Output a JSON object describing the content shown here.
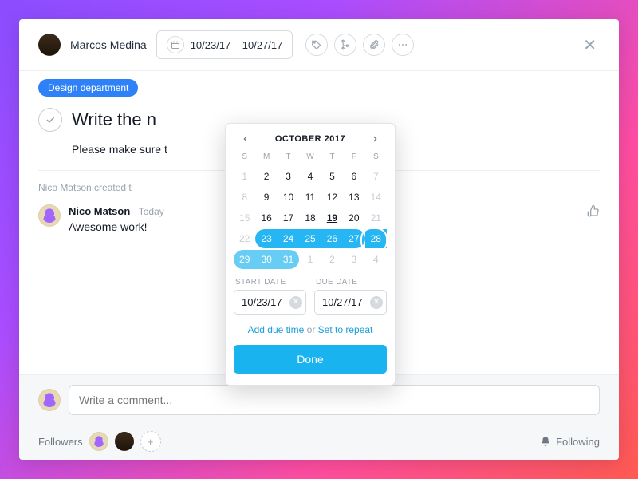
{
  "header": {
    "assignee": "Marcos Medina",
    "date_chip": "10/23/17 – 10/27/17"
  },
  "project_pill": "Design department",
  "task_title": "Write the n",
  "description": "Please make sure t",
  "activity_meta": "Nico Matson created t",
  "comment": {
    "author": "Nico Matson",
    "when": "Today",
    "text": "Awesome work!"
  },
  "comment_bar": {
    "placeholder": "Write a comment..."
  },
  "followers_label": "Followers",
  "following_label": "Following",
  "datepicker": {
    "month_label": "OCTOBER 2017",
    "dow": [
      "S",
      "M",
      "T",
      "W",
      "T",
      "F",
      "S"
    ],
    "start_label": "START DATE",
    "due_label": "DUE DATE",
    "start_value": "10/23/17",
    "due_value": "10/27/17",
    "add_time": "Add due time",
    "or": " or ",
    "repeat": "Set to repeat",
    "done": "Done"
  }
}
